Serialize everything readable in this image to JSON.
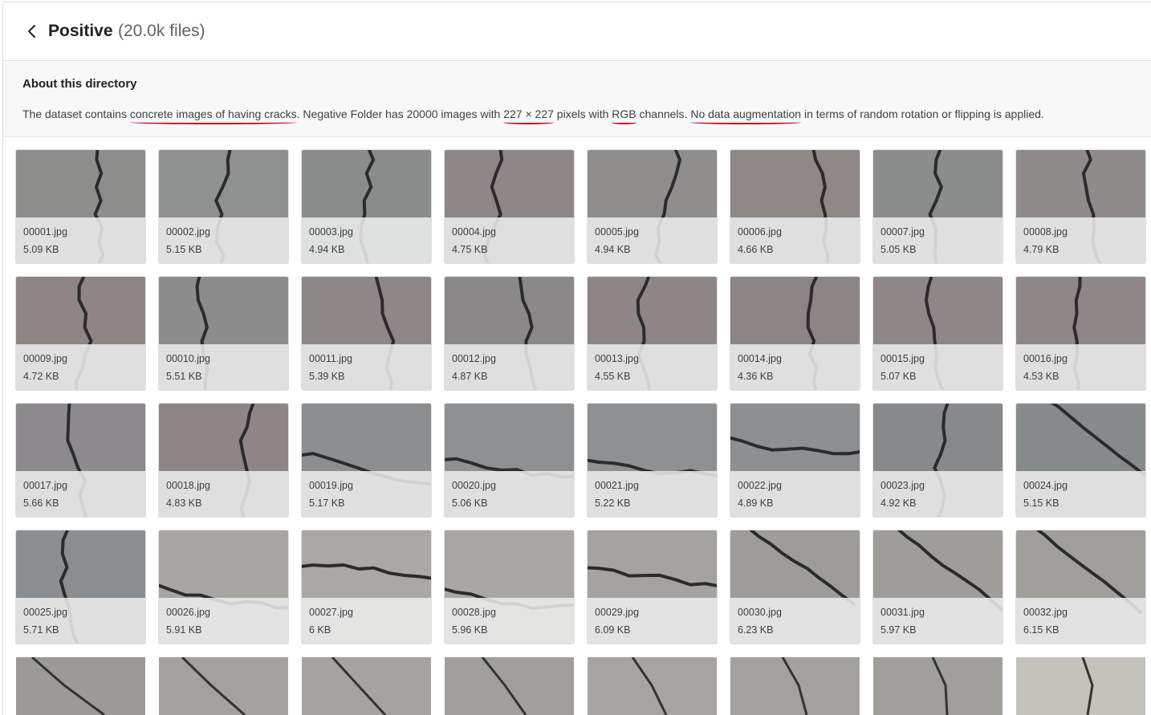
{
  "header": {
    "back_icon": "chevron-left-icon",
    "title": "Positive",
    "count": "(20.0k files)"
  },
  "about": {
    "heading": "About this directory",
    "text_parts": [
      "The dataset contains ",
      "concrete images of having cracks",
      ". Negative Folder has 20000 images with ",
      "227 × 227",
      " pixels with ",
      "RGB",
      " channels. ",
      "No data augmentation",
      " in terms of random rotation or flipping is applied."
    ],
    "annotation_color": "#d0021b"
  },
  "files": [
    {
      "name": "00001.jpg",
      "size": "5.09 KB",
      "tone": "#8d8e8c",
      "crack": "v"
    },
    {
      "name": "00002.jpg",
      "size": "5.15 KB",
      "tone": "#8f9090",
      "crack": "v"
    },
    {
      "name": "00003.jpg",
      "size": "4.94 KB",
      "tone": "#8a8c8b",
      "crack": "v"
    },
    {
      "name": "00004.jpg",
      "size": "4.75 KB",
      "tone": "#8e8788",
      "crack": "v"
    },
    {
      "name": "00005.jpg",
      "size": "4.94 KB",
      "tone": "#8f8e8d",
      "crack": "v"
    },
    {
      "name": "00006.jpg",
      "size": "4.66 KB",
      "tone": "#8e8886",
      "crack": "v"
    },
    {
      "name": "00007.jpg",
      "size": "5.05 KB",
      "tone": "#8b8d8d",
      "crack": "v"
    },
    {
      "name": "00008.jpg",
      "size": "4.79 KB",
      "tone": "#8f8b8b",
      "crack": "v"
    },
    {
      "name": "00009.jpg",
      "size": "4.72 KB",
      "tone": "#8f8585",
      "crack": "v"
    },
    {
      "name": "00010.jpg",
      "size": "5.51 KB",
      "tone": "#8c8c8c",
      "crack": "v"
    },
    {
      "name": "00011.jpg",
      "size": "5.39 KB",
      "tone": "#8e8788",
      "crack": "v"
    },
    {
      "name": "00012.jpg",
      "size": "4.87 KB",
      "tone": "#8a8889",
      "crack": "v"
    },
    {
      "name": "00013.jpg",
      "size": "4.55 KB",
      "tone": "#8e8686",
      "crack": "v"
    },
    {
      "name": "00014.jpg",
      "size": "4.36 KB",
      "tone": "#8c8585",
      "crack": "v"
    },
    {
      "name": "00015.jpg",
      "size": "5.07 KB",
      "tone": "#8e8788",
      "crack": "v"
    },
    {
      "name": "00016.jpg",
      "size": "4.53 KB",
      "tone": "#8e8787",
      "crack": "v"
    },
    {
      "name": "00017.jpg",
      "size": "5.66 KB",
      "tone": "#8c8a8c",
      "crack": "v"
    },
    {
      "name": "00018.jpg",
      "size": "4.83 KB",
      "tone": "#8e8586",
      "crack": "v"
    },
    {
      "name": "00019.jpg",
      "size": "5.17 KB",
      "tone": "#8c8e8f",
      "crack": "h"
    },
    {
      "name": "00020.jpg",
      "size": "5.06 KB",
      "tone": "#8e9091",
      "crack": "h"
    },
    {
      "name": "00021.jpg",
      "size": "5.22 KB",
      "tone": "#8e9091",
      "crack": "h"
    },
    {
      "name": "00022.jpg",
      "size": "4.89 KB",
      "tone": "#8d8f90",
      "crack": "h"
    },
    {
      "name": "00023.jpg",
      "size": "4.92 KB",
      "tone": "#87898a",
      "crack": "v"
    },
    {
      "name": "00024.jpg",
      "size": "5.15 KB",
      "tone": "#868a8b",
      "crack": "d"
    },
    {
      "name": "00025.jpg",
      "size": "5.71 KB",
      "tone": "#8b8e90",
      "crack": "v"
    },
    {
      "name": "00026.jpg",
      "size": "5.91 KB",
      "tone": "#a8a6a2",
      "crack": "h"
    },
    {
      "name": "00027.jpg",
      "size": "6 KB",
      "tone": "#aaa8a4",
      "crack": "h"
    },
    {
      "name": "00028.jpg",
      "size": "5.96 KB",
      "tone": "#a9a7a3",
      "crack": "h"
    },
    {
      "name": "00029.jpg",
      "size": "6.09 KB",
      "tone": "#a5a3a0",
      "crack": "h"
    },
    {
      "name": "00030.jpg",
      "size": "6.23 KB",
      "tone": "#9d9c99",
      "crack": "d"
    },
    {
      "name": "00031.jpg",
      "size": "5.97 KB",
      "tone": "#9e9d9a",
      "crack": "d"
    },
    {
      "name": "00032.jpg",
      "size": "6.15 KB",
      "tone": "#a09f9c",
      "crack": "d"
    }
  ],
  "partial_row_tones": [
    "#9b9a97",
    "#a3a19e",
    "#a5a3a0",
    "#a09f9c",
    "#a7a5a1",
    "#a2a19e",
    "#a09f9b",
    "#c4c2bd"
  ]
}
